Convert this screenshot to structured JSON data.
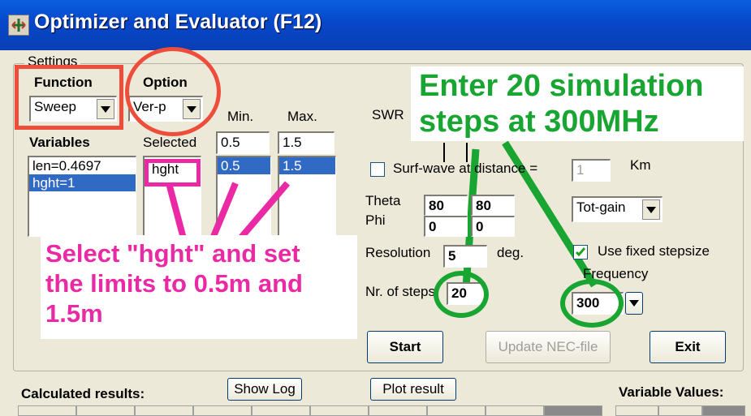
{
  "window": {
    "title": "Optimizer and Evaluator (F12)",
    "icon": "app-icon"
  },
  "settings": {
    "legend": "Settings",
    "function": {
      "label": "Function",
      "value": "Sweep"
    },
    "option": {
      "label": "Option",
      "value": "Ver-p"
    },
    "min_label": "Min.",
    "max_label": "Max.",
    "variables_label": "Variables",
    "selected_label": "Selected",
    "variables": [
      "len=0.4697",
      "hght=1"
    ],
    "selected_variable": "hght",
    "min_value": "0.5",
    "max_value": "1.5",
    "min_list": [
      "0.5"
    ],
    "max_list": [
      "1.5"
    ],
    "swr_label": "SWR",
    "surf_wave_label": "Surf-wave at distance =",
    "surf_wave_value": "1",
    "km_label": "Km",
    "theta_label": "Theta",
    "phi_label": "Phi",
    "theta_from": "80",
    "theta_to": "80",
    "phi_from": "0",
    "phi_to": "0",
    "gain_select": "Tot-gain",
    "resolution_label": "Resolution",
    "resolution_value": "5",
    "deg_label": "deg.",
    "fixed_step_label": "Use fixed stepsize",
    "fixed_step_checked": true,
    "frequency_label": "Frequency",
    "steps_label": "Nr. of steps",
    "steps_value": "20",
    "frequency_value": "300"
  },
  "buttons": {
    "start": "Start",
    "update_nec": "Update NEC-file",
    "exit": "Exit",
    "show_log": "Show Log",
    "plot_result": "Plot result"
  },
  "bottom": {
    "calculated_results": "Calculated results:",
    "variable_values": "Variable Values:"
  },
  "annotations": {
    "pink_line1": "Select \"hght\" and set",
    "pink_line2": "the limits to 0.5m and",
    "pink_line3": "1.5m",
    "green_line1": "Enter 20 simulation",
    "green_line2": "steps at 300MHz"
  },
  "colors": {
    "annotation_red": "#ef4d3c",
    "annotation_pink": "#ea2aa4",
    "annotation_green": "#19a532",
    "selection": "#316ac5",
    "titlebar": "#0a4fd4"
  }
}
